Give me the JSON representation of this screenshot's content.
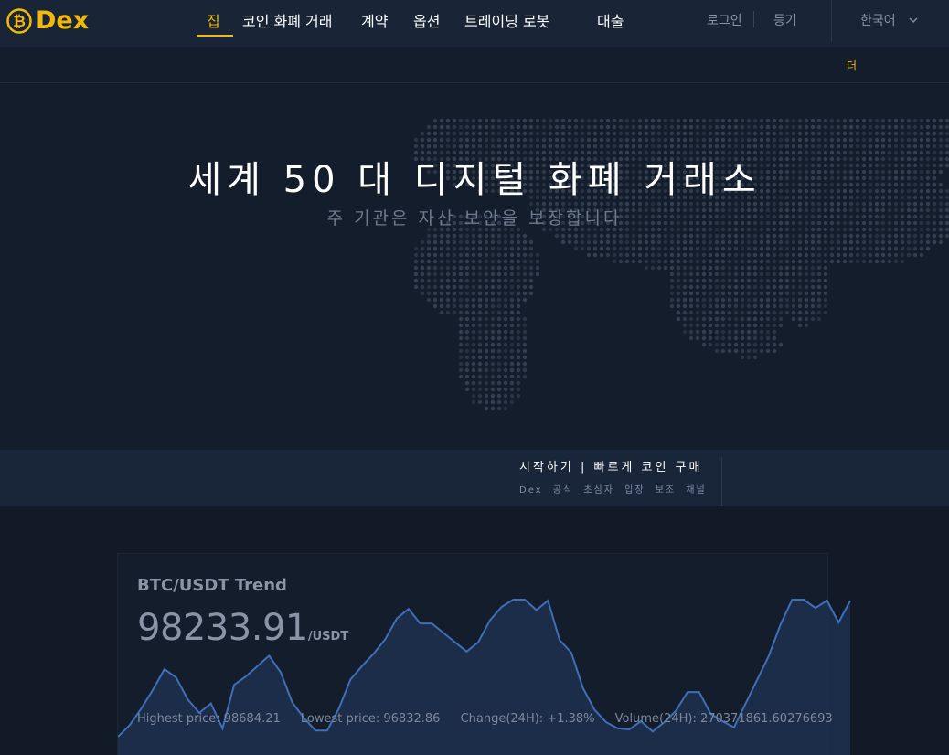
{
  "brand": {
    "name": "Dex",
    "color": "#f0b90b",
    "logo_glyph": "₿"
  },
  "nav": {
    "items": [
      {
        "label": "집",
        "active": true
      },
      {
        "label": "코인 화폐 거래",
        "active": false
      },
      {
        "label": "계약",
        "active": false
      },
      {
        "label": "옵션",
        "active": false
      },
      {
        "label": "트레이딩 로봇",
        "active": false
      },
      {
        "label": "대출",
        "active": false
      }
    ]
  },
  "header": {
    "login_label": "로그인",
    "register_label": "등기",
    "language_label": "한국어",
    "language_icon": "chevron-down-icon"
  },
  "notice": {
    "text": "더"
  },
  "hero": {
    "title": "세계 50 대 디지털 화폐 거래소",
    "subtitle": "주 기관은 자산 보안을 보장합니다"
  },
  "start_band": {
    "title": "시작하기 | 빠르게 코인 구매",
    "subtitle": "Dex 공식 초심자 입장 보조 채널"
  },
  "trend": {
    "title": "BTC/USDT Trend",
    "price": "98233.91",
    "unit": "/USDT",
    "highest": "Highest price: 98684.21",
    "lowest": "Lowest price: 96832.86",
    "change": "Change(24H): +1.38%",
    "volume": "Volume(24H): 270371861.60276693",
    "line_color": "#3f6fb6",
    "fill_color": "#1f3355",
    "series": [
      96900,
      97010,
      97170,
      97350,
      97550,
      97470,
      97260,
      97130,
      97220,
      96980,
      97400,
      97480,
      97580,
      97680,
      97520,
      97230,
      97080,
      96960,
      96960,
      97170,
      97450,
      97580,
      97700,
      97840,
      98040,
      98130,
      97990,
      97990,
      97900,
      97810,
      97720,
      97810,
      98020,
      98150,
      98220,
      98220,
      98120,
      98210,
      97830,
      97710,
      97370,
      97160,
      97040,
      96980,
      96970,
      97050,
      96950,
      97040,
      97150,
      97330,
      97330,
      97120,
      97050,
      96990,
      97220,
      97450,
      97680,
      97980,
      98220,
      98220,
      98140,
      98210,
      98000,
      98210
    ]
  }
}
